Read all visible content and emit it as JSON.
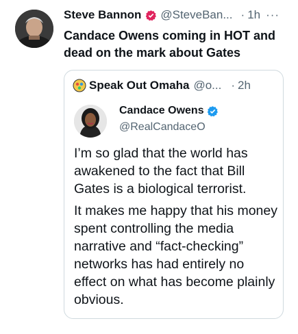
{
  "tweet": {
    "author_name": "Steve Bannon",
    "author_handle": "@SteveBan...",
    "separator": "·",
    "time": "1h",
    "more": "···",
    "text": "Candace Owens coming in HOT and dead on the mark about Gates"
  },
  "quote": {
    "author_name": "Speak Out Omaha",
    "author_handle": "@o...",
    "separator": "·",
    "time": "2h",
    "embedded": {
      "name": "Candace Owens",
      "handle": "@RealCandaceO",
      "paragraphs": [
        "I’m so glad that the world has awakened to the fact that Bill Gates is a biological terrorist.",
        "It makes me happy that his money spent controlling the media narrative and “fact-checking” networks has had entirely no effect on what has become plainly obvious."
      ]
    }
  },
  "colors": {
    "text": "#0f1419",
    "secondary": "#536471",
    "border": "#cfd9de",
    "verified_blue": "#1d9bf0",
    "verified_red": "#e0245e"
  },
  "icons": {
    "author_verified": "verified-badge-red-icon",
    "embedded_verified": "verified-badge-blue-icon",
    "more": "more-horizontal-icon"
  }
}
